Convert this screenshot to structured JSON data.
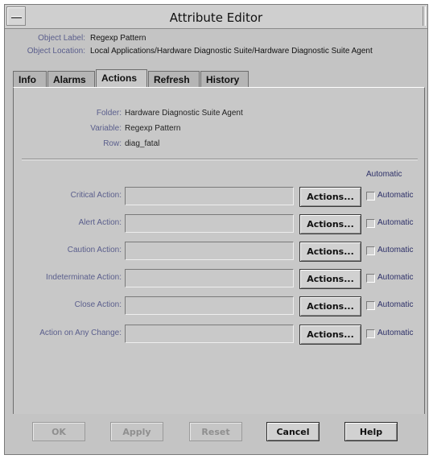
{
  "window": {
    "title": "Attribute Editor"
  },
  "info": {
    "object_label_label": "Object Label:",
    "object_label_value": "Regexp Pattern",
    "object_location_label": "Object Location:",
    "object_location_value": "Local Applications/Hardware Diagnostic Suite/Hardware Diagnostic Suite Agent"
  },
  "tabs": [
    {
      "label": "Info"
    },
    {
      "label": "Alarms"
    },
    {
      "label": "Actions"
    },
    {
      "label": "Refresh"
    },
    {
      "label": "History"
    }
  ],
  "active_tab": "Actions",
  "fields": {
    "folder_label": "Folder:",
    "folder_value": "Hardware Diagnostic Suite Agent",
    "variable_label": "Variable:",
    "variable_value": "Regexp Pattern",
    "row_label": "Row:",
    "row_value": "diag_fatal"
  },
  "automatic_header": "Automatic",
  "actions": [
    {
      "label": "Critical Action:",
      "value": "",
      "button": "Actions...",
      "auto_label": "Automatic",
      "checked": false
    },
    {
      "label": "Alert Action:",
      "value": "",
      "button": "Actions...",
      "auto_label": "Automatic",
      "checked": false
    },
    {
      "label": "Caution Action:",
      "value": "",
      "button": "Actions...",
      "auto_label": "Automatic",
      "checked": false
    },
    {
      "label": "Indeterminate Action:",
      "value": "",
      "button": "Actions...",
      "auto_label": "Automatic",
      "checked": false
    },
    {
      "label": "Close Action:",
      "value": "",
      "button": "Actions...",
      "auto_label": "Automatic",
      "checked": false
    },
    {
      "label": "Action on Any Change:",
      "value": "",
      "button": "Actions...",
      "auto_label": "Automatic",
      "checked": false
    }
  ],
  "footer": {
    "ok": "OK",
    "apply": "Apply",
    "reset": "Reset",
    "cancel": "Cancel",
    "help": "Help"
  }
}
